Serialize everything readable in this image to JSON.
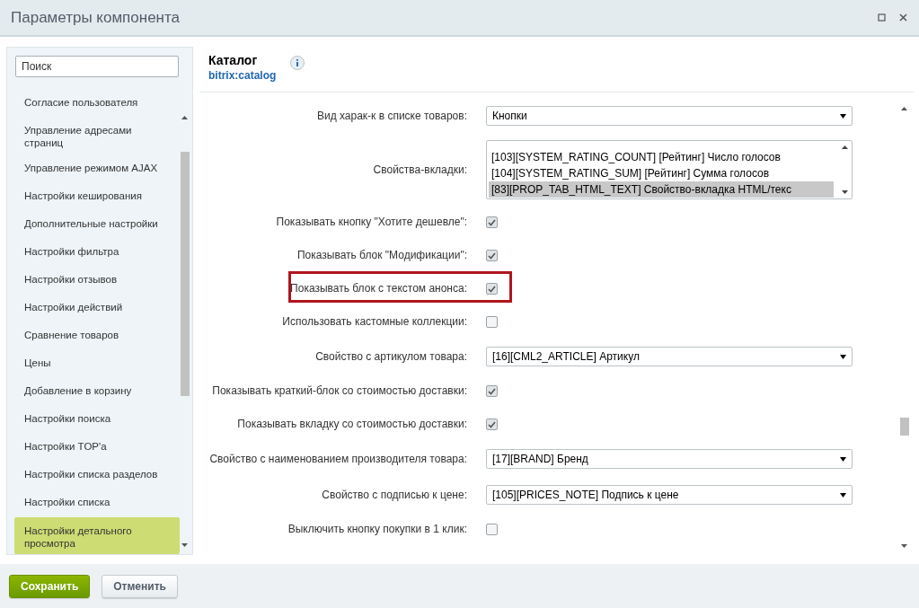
{
  "window": {
    "title": "Параметры компонента"
  },
  "sidebar": {
    "search": {
      "placeholder": "Поиск"
    },
    "items": [
      {
        "label": "Согласие пользователя",
        "selected": false
      },
      {
        "label": "Управление адресами страниц",
        "selected": false
      },
      {
        "label": "Управление режимом AJAX",
        "selected": false
      },
      {
        "label": "Настройки кеширования",
        "selected": false
      },
      {
        "label": "Дополнительные настройки",
        "selected": false
      },
      {
        "label": "Настройки фильтра",
        "selected": false
      },
      {
        "label": "Настройки отзывов",
        "selected": false
      },
      {
        "label": "Настройки действий",
        "selected": false
      },
      {
        "label": "Сравнение товаров",
        "selected": false
      },
      {
        "label": "Цены",
        "selected": false
      },
      {
        "label": "Добавление в корзину",
        "selected": false
      },
      {
        "label": "Настройки поиска",
        "selected": false
      },
      {
        "label": "Настройки TOP'a",
        "selected": false
      },
      {
        "label": "Настройки списка разделов",
        "selected": false
      },
      {
        "label": "Настройки списка",
        "selected": false
      },
      {
        "label": "Настройки детального просмотра",
        "selected": true
      }
    ]
  },
  "component": {
    "title": "Каталог",
    "code": "bitrix:catalog"
  },
  "rows": [
    {
      "kind": "select",
      "label": "Вид харак-к в списке товаров:",
      "value": "Кнопки",
      "highlighted": false
    },
    {
      "kind": "listbox",
      "label": "Свойства-вкладки:",
      "highlighted": false,
      "options": [
        {
          "label": "[103][SYSTEM_RATING_COUNT] [Рейтинг] Число голосов",
          "selected": false
        },
        {
          "label": "[104][SYSTEM_RATING_SUM] [Рейтинг] Сумма голосов",
          "selected": false
        },
        {
          "label": "[83][PROP_TAB_HTML_TEXT] Свойство-вкладка HTML/текс",
          "selected": true
        }
      ]
    },
    {
      "kind": "checkbox",
      "label": "Показывать кнопку \"Хотите дешевле\":",
      "checked": true,
      "highlighted": false
    },
    {
      "kind": "checkbox",
      "label": "Показывать блок \"Модификации\":",
      "checked": true,
      "highlighted": false
    },
    {
      "kind": "checkbox",
      "label": "Показывать блок с текстом анонса:",
      "checked": true,
      "highlighted": true
    },
    {
      "kind": "checkbox",
      "label": "Использовать кастомные коллекции:",
      "checked": false,
      "highlighted": false
    },
    {
      "kind": "select",
      "label": "Свойство с артикулом товара:",
      "value": "[16][CML2_ARTICLE] Артикул",
      "highlighted": false
    },
    {
      "kind": "checkbox",
      "label": "Показывать краткий-блок со стоимостью доставки:",
      "checked": true,
      "highlighted": false
    },
    {
      "kind": "checkbox",
      "label": "Показывать вкладку со стоимостью доставки:",
      "checked": true,
      "highlighted": false
    },
    {
      "kind": "select",
      "label": "Свойство с наименованием производителя товара:",
      "value": "[17][BRAND] Бренд",
      "highlighted": false
    },
    {
      "kind": "select",
      "label": "Свойство с подписью к цене:",
      "value": "[105][PRICES_NOTE] Подпись к цене",
      "highlighted": false
    },
    {
      "kind": "checkbox",
      "label": "Выключить кнопку покупки в 1 клик:",
      "checked": false,
      "highlighted": false
    }
  ],
  "buttons": [
    {
      "label": "Сохранить",
      "kind": "primary"
    },
    {
      "label": "Отменить",
      "kind": "secondary"
    }
  ]
}
